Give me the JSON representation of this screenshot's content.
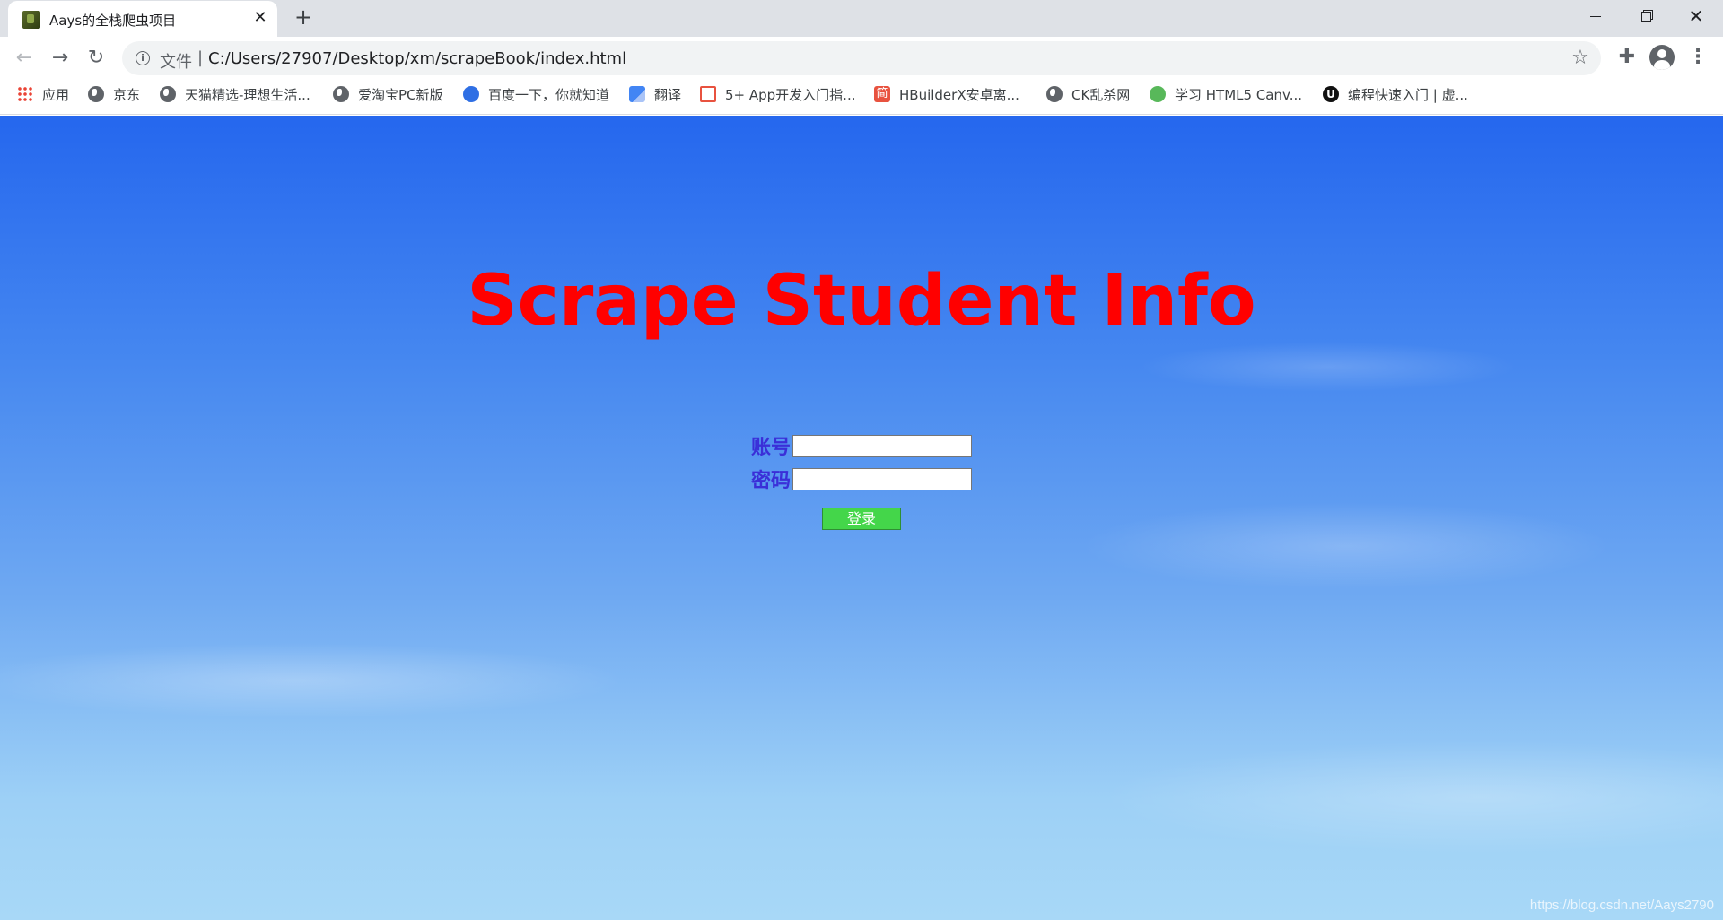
{
  "browser": {
    "tab": {
      "title": "Aays的全栈爬虫项目"
    },
    "address_bar": {
      "scheme_label": "文件",
      "separator": "|",
      "url": "C:/Users/27907/Desktop/xm/scrapeBook/index.html"
    },
    "bookmarks": [
      {
        "label": "应用",
        "icon": "apps-grid-icon"
      },
      {
        "label": "京东",
        "icon": "globe-icon"
      },
      {
        "label": "天猫精选-理想生活...",
        "icon": "globe-icon"
      },
      {
        "label": "爱淘宝PC新版",
        "icon": "globe-icon"
      },
      {
        "label": "百度一下，你就知道",
        "icon": "baidu-paw-icon"
      },
      {
        "label": "翻译",
        "icon": "translate-icon"
      },
      {
        "label": "5+ App开发入门指...",
        "icon": "dcloud-icon"
      },
      {
        "label": "HBuilderX安卓离...",
        "icon": "jian-icon"
      },
      {
        "label": "CK乱杀网",
        "icon": "globe-icon"
      },
      {
        "label": "学习 HTML5 Canv...",
        "icon": "green-circle-icon"
      },
      {
        "label": "编程快速入门 | 虚...",
        "icon": "unreal-icon"
      }
    ]
  },
  "page": {
    "title": "Scrape Student Info",
    "form": {
      "account_label": "账号",
      "account_value": "",
      "password_label": "密码",
      "password_value": "",
      "login_label": "登录"
    },
    "watermark": "https://blog.csdn.net/Aays2790"
  },
  "colors": {
    "title": "#ff0000",
    "label": "#3a2fd8",
    "login_button": "#44d64a",
    "sky_top": "#2567ee",
    "sky_bottom": "#a8d8f7"
  }
}
